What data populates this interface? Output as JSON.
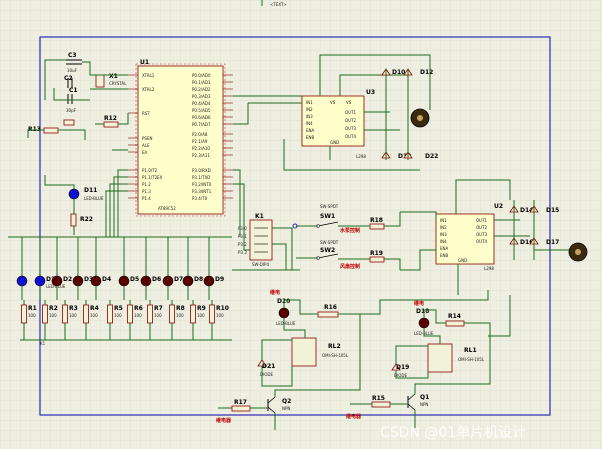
{
  "watermark": "CSDN @01单片机设计",
  "colors": {
    "background": "#efefe1",
    "grid": "#d9d9c6",
    "border": "#2b2bb8",
    "wire": "#1e6b1e",
    "component": "#8b0000",
    "led_blue": "#1010d0",
    "led_red": "#5a0000"
  },
  "mcu": {
    "ref": "U1",
    "part": "AT89C52"
  },
  "crystal": {
    "ref": "X1",
    "part": "CRYSTAL"
  },
  "capacitors": [
    {
      "ref": "C1",
      "value": "30pF"
    },
    {
      "ref": "C2",
      "value": "30pF"
    },
    {
      "ref": "C3",
      "value": "10uF"
    }
  ],
  "power_led": {
    "ref": "D11",
    "part": "LED-BLUE"
  },
  "led_row": [
    "D1",
    "D2",
    "D3",
    "D4",
    "D5",
    "D6",
    "D7",
    "D8",
    "D9"
  ],
  "resistor_row": [
    "R1",
    "R2",
    "R3",
    "R4",
    "R5",
    "R6",
    "R7",
    "R8",
    "R9",
    "R10"
  ],
  "resistor_value": "100",
  "resistor_misc": [
    "R11",
    "R12",
    "R13",
    "R22"
  ],
  "switch_pack": {
    "ref": "K1",
    "part": "SW-DIP4"
  },
  "switches": [
    {
      "ref": "SW1",
      "part": "SW-SPDT",
      "label": "水泵控制"
    },
    {
      "ref": "SW2",
      "part": "SW-SPDT",
      "label": "风扇控制"
    }
  ],
  "drivers": [
    {
      "ref": "U3",
      "part": "L298",
      "diodes": [
        "D10",
        "D12",
        "D13",
        "D22"
      ]
    },
    {
      "ref": "U2",
      "part": "L298",
      "diodes": [
        "D14",
        "D15",
        "D16",
        "D17"
      ]
    }
  ],
  "relay_blocks": [
    {
      "led": "D20",
      "relay": "RL2",
      "diode": "D21",
      "resistor": "R16",
      "base_res": "R17",
      "transistor": "Q2",
      "led_label": "继电",
      "ctrl_label": "继电器"
    },
    {
      "led": "D18",
      "relay": "RL1",
      "diode": "D19",
      "resistor": "R14",
      "base_res": "R15",
      "transistor": "Q1",
      "led_label": "继电",
      "ctrl_label": "继电器"
    }
  ],
  "misc_refs": [
    "R18",
    "R19"
  ],
  "text_small": {
    "relay_part": "OMI-SH-105L",
    "transistor_part": "NPN",
    "led_part": "LED-BLUE",
    "diode_part": "DIODE",
    "texta": "<TEXT>"
  }
}
